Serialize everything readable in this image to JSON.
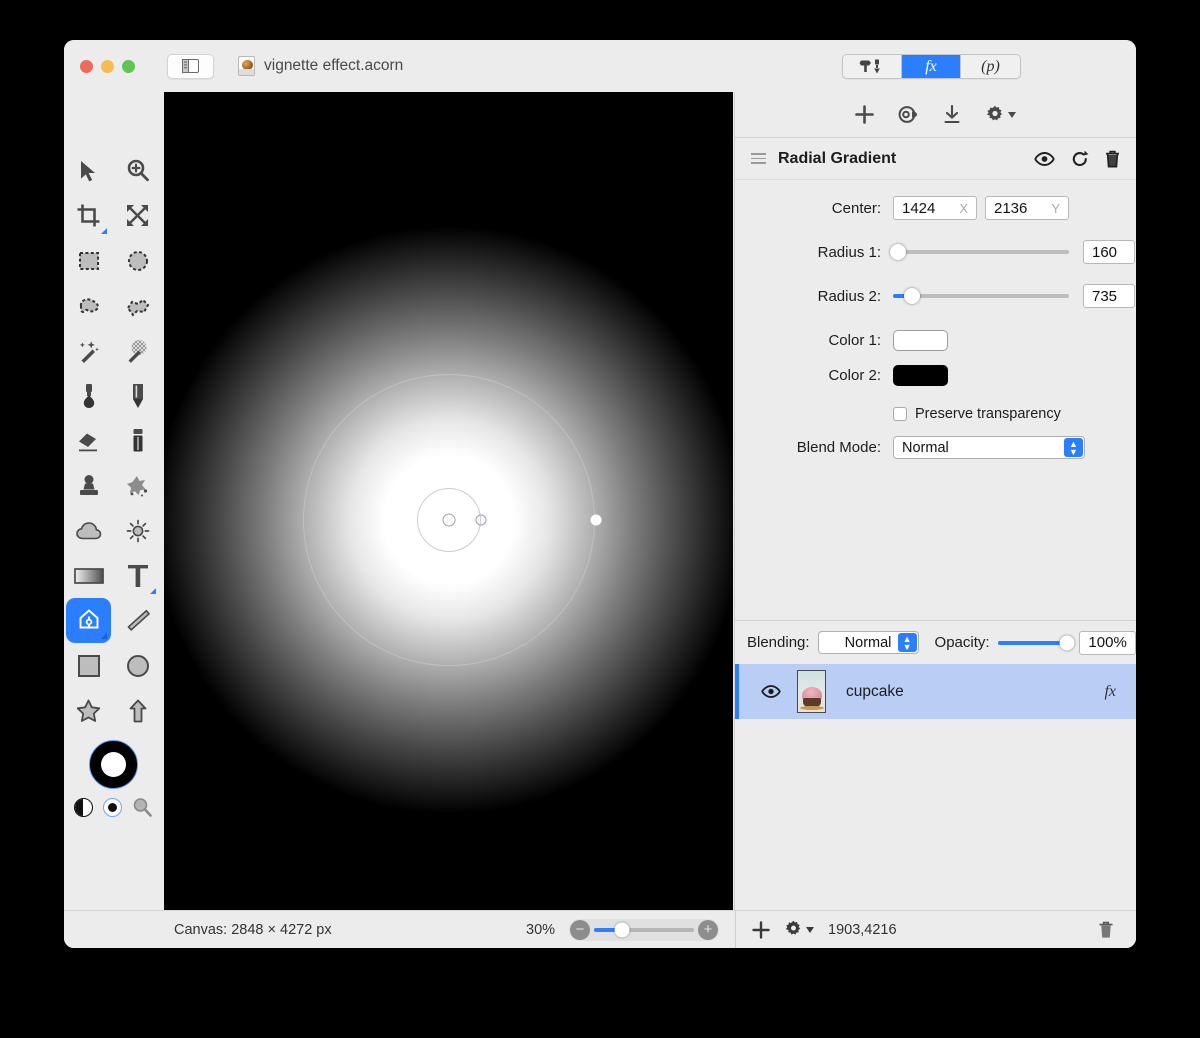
{
  "window": {
    "title": "vignette effect.acorn",
    "doc_icon": "acorn-document-icon",
    "traffic_lights": [
      "close",
      "minimize",
      "zoom"
    ]
  },
  "titlebar": {
    "sidebar_toggle": "sidebar-toggle-icon",
    "segments": [
      {
        "id": "tools",
        "label": "",
        "icon": "hammer-pen-icon",
        "active": false
      },
      {
        "id": "filters",
        "label": "fx",
        "icon": "fx-icon",
        "active": true
      },
      {
        "id": "palette",
        "label": "(p)",
        "icon": "presets-icon",
        "active": false
      }
    ]
  },
  "toolbar": {
    "tools": [
      {
        "name": "move-tool",
        "icon": "arrow-cursor-icon",
        "selected": false,
        "has_corner": false
      },
      {
        "name": "zoom-tool",
        "icon": "magnifier-plus-icon",
        "selected": false,
        "has_corner": false
      },
      {
        "name": "crop-tool",
        "icon": "crop-icon",
        "selected": false,
        "has_corner": true
      },
      {
        "name": "transform-tool",
        "icon": "move-arrows-icon",
        "selected": false,
        "has_corner": false
      },
      {
        "name": "rect-select-tool",
        "icon": "rectangle-marquee-icon",
        "selected": false,
        "has_corner": false
      },
      {
        "name": "ellipse-select-tool",
        "icon": "ellipse-marquee-icon",
        "selected": false,
        "has_corner": false
      },
      {
        "name": "lasso-tool",
        "icon": "lasso-icon",
        "selected": false,
        "has_corner": false
      },
      {
        "name": "polygon-lasso-tool",
        "icon": "polygon-lasso-icon",
        "selected": false,
        "has_corner": false
      },
      {
        "name": "magic-wand-tool",
        "icon": "magic-wand-icon",
        "selected": false,
        "has_corner": false
      },
      {
        "name": "instant-alpha-tool",
        "icon": "instant-alpha-icon",
        "selected": false,
        "has_corner": false
      },
      {
        "name": "brush-tool",
        "icon": "brush-icon",
        "selected": false,
        "has_corner": false
      },
      {
        "name": "pencil-tool",
        "icon": "pencil-icon",
        "selected": false,
        "has_corner": false
      },
      {
        "name": "eraser-tool",
        "icon": "eraser-icon",
        "selected": false,
        "has_corner": false
      },
      {
        "name": "smudge-tool",
        "icon": "smudge-icon",
        "selected": false,
        "has_corner": false
      },
      {
        "name": "clone-stamp-tool",
        "icon": "clone-stamp-icon",
        "selected": false,
        "has_corner": false
      },
      {
        "name": "healing-tool",
        "icon": "healing-splatter-icon",
        "selected": false,
        "has_corner": false
      },
      {
        "name": "blur-tool",
        "icon": "cloud-blur-icon",
        "selected": false,
        "has_corner": false
      },
      {
        "name": "dodge-burn-tool",
        "icon": "sun-dodge-icon",
        "selected": false,
        "has_corner": false
      },
      {
        "name": "gradient-tool",
        "icon": "gradient-rectangle-icon",
        "selected": false,
        "has_corner": false
      },
      {
        "name": "text-tool",
        "icon": "text-t-icon",
        "selected": false,
        "has_corner": true
      },
      {
        "name": "bezier-pen-tool",
        "icon": "pen-nib-icon",
        "selected": true,
        "has_corner": true
      },
      {
        "name": "line-tool",
        "icon": "line-icon",
        "selected": false,
        "has_corner": false
      },
      {
        "name": "rectangle-tool",
        "icon": "square-shape-icon",
        "selected": false,
        "has_corner": false
      },
      {
        "name": "ellipse-tool",
        "icon": "circle-shape-icon",
        "selected": false,
        "has_corner": false
      },
      {
        "name": "star-tool",
        "icon": "star-shape-icon",
        "selected": false,
        "has_corner": false
      },
      {
        "name": "arrow-tool",
        "icon": "arrow-shape-icon",
        "selected": false,
        "has_corner": false
      }
    ],
    "color_widget": {
      "foreground": "#ffffff",
      "background": "#000000",
      "swap_icon": "swap-colors-icon",
      "reset_icon": "default-colors-icon",
      "picker_icon": "color-picker-magnifier-icon"
    }
  },
  "filter_panel": {
    "action_icons": [
      {
        "name": "add-filter-icon",
        "glyph": "+"
      },
      {
        "name": "filter-presets-icon",
        "glyph": "◎"
      },
      {
        "name": "download-filter-icon",
        "glyph": "↓"
      },
      {
        "name": "filter-settings-gear-icon",
        "glyph": "⚙"
      }
    ],
    "header": {
      "drag_handle_icon": "hamburger-drag-icon",
      "title": "Radial Gradient",
      "icons": [
        {
          "name": "eye-visibility-icon"
        },
        {
          "name": "reset-filter-icon"
        },
        {
          "name": "delete-filter-icon"
        }
      ]
    },
    "fields": {
      "center_label": "Center:",
      "center_x": "1424",
      "center_x_unit": "X",
      "center_y": "2136",
      "center_y_unit": "Y",
      "radius1_label": "Radius 1:",
      "radius1_value": "160",
      "radius1_pct": 3,
      "radius2_label": "Radius 2:",
      "radius2_value": "735",
      "radius2_pct": 11,
      "color1_label": "Color 1:",
      "color1_value": "#ffffff",
      "color2_label": "Color 2:",
      "color2_value": "#000000",
      "preserve_transparency_label": "Preserve transparency",
      "preserve_transparency_checked": false,
      "blend_mode_label": "Blend Mode:",
      "blend_mode_value": "Normal"
    }
  },
  "layers_panel": {
    "blending_label": "Blending:",
    "blending_value": "Normal",
    "opacity_label": "Opacity:",
    "opacity_value": "100%",
    "opacity_pct": 100,
    "layers": [
      {
        "name": "cupcake",
        "visible": true,
        "visibility_icon": "eye-icon",
        "thumbnail": "cupcake-thumbnail",
        "fx_badge": "fx",
        "selected": true
      }
    ]
  },
  "statusbar": {
    "canvas_label": "Canvas: 2848 × 4272 px",
    "zoom_percent": "30%",
    "zoom_out_icon": "zoom-out-icon",
    "zoom_in_icon": "zoom-in-icon",
    "zoom_slider_pct": 28,
    "add_layer_icon": "add-layer-icon",
    "layer-gear-icon": "layer-settings-gear-icon",
    "coordinates": "1903,4216",
    "delete_layer_icon": "delete-layer-trash-icon"
  },
  "canvas": {
    "background": "#000000",
    "gradient": {
      "type": "radial",
      "inner_color": "#ffffff",
      "outer_color": "#000000",
      "center_handle": "center-handle",
      "radius1_handle": "radius1-handle",
      "radius2_handle": "radius2-handle"
    }
  },
  "colors": {
    "accent": "#2b7fff",
    "chrome": "#ececec",
    "selected_row": "#b9cdf5"
  }
}
